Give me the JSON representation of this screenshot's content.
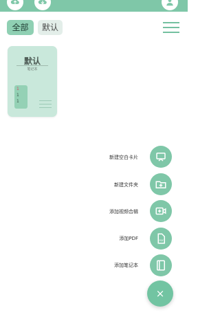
{
  "icons": {
    "cloud_upload": "cloud-upload-icon",
    "cloud_download": "cloud-download-icon",
    "user": "user-icon",
    "menu": "menu-icon",
    "close": "close-icon"
  },
  "tabs": [
    {
      "label": "全部",
      "selected": true
    },
    {
      "label": "默认",
      "selected": false
    }
  ],
  "notebook": {
    "title": "默认",
    "subtitle": "笔记本",
    "spine_lines": [
      "1",
      "1",
      "1"
    ]
  },
  "actions": [
    {
      "label": "新建空白卡片",
      "icon": "blank-card-icon"
    },
    {
      "label": "新建文件夹",
      "icon": "new-folder-icon"
    },
    {
      "label": "添加视频合辑",
      "icon": "video-collection-icon"
    },
    {
      "label": "添加PDF",
      "icon": "pdf-icon"
    },
    {
      "label": "添加笔记本",
      "icon": "notebook-icon"
    }
  ],
  "fab": {
    "symbol": "×"
  },
  "colors": {
    "accent": "#7fc7a8",
    "tab_selected": "#8fd0b3",
    "tab_unselected": "#e3eee9",
    "notebook_card": "#c9e8db"
  }
}
